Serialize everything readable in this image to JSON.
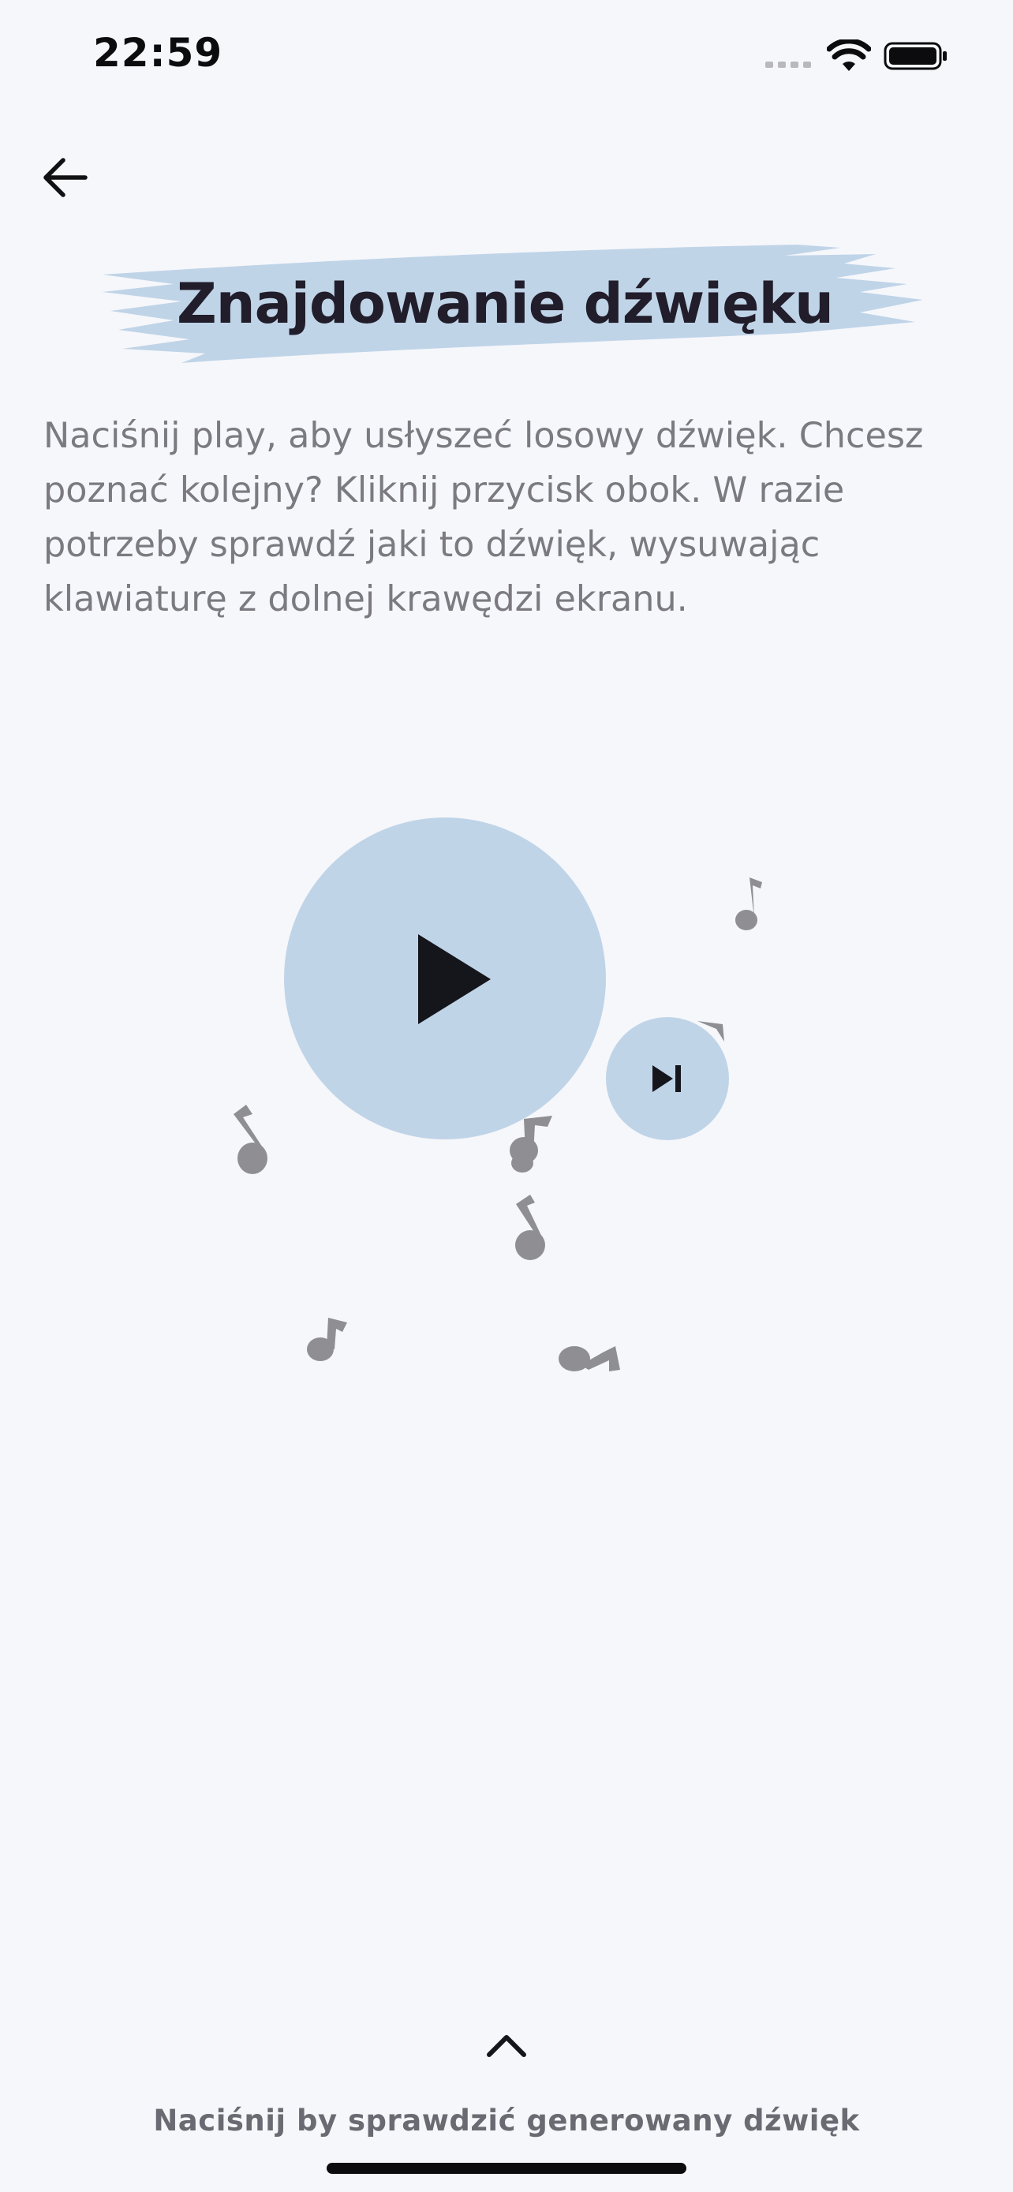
{
  "status_bar": {
    "time": "22:59"
  },
  "header": {
    "back_icon": "arrow-left-icon"
  },
  "main": {
    "title": "Znajdowanie dźwięku",
    "description": "Naciśnij play, aby usłyszeć losowy dźwięk. Chcesz poznać kolejny? Kliknij przycisk obok.   W razie potrzeby sprawdź jaki to dźwięk, wysuwając klawiaturę z dolnej krawędzi ekranu.",
    "play_icon": "play-icon",
    "skip_icon": "skip-next-icon",
    "decoration_icon": "music-note-icon"
  },
  "bottom": {
    "expand_icon": "chevron-up-icon",
    "hint": "Naciśnij by sprawdzić generowany dźwięk"
  },
  "colors": {
    "background": "#f6f7fb",
    "accent": "#c0d4e8",
    "title_text": "#211d2a",
    "body_text": "#7b7a80",
    "note_gray": "#8f8f93"
  }
}
